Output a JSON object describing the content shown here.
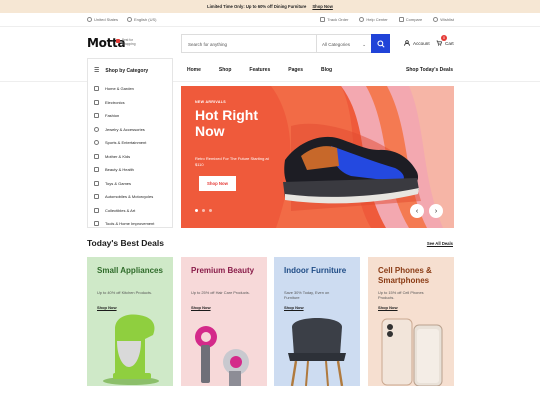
{
  "promo": {
    "text": "Limited Time Only: Up to 60% off Dining Furniture",
    "link": "Shop Now"
  },
  "utility": {
    "country": "United States",
    "language": "English (US)",
    "right": [
      "Track Order",
      "Help Center",
      "Compare",
      "Wishlist"
    ]
  },
  "header": {
    "logo": "Motta",
    "tagline": "Best for Shopping",
    "search_placeholder": "Search for anything",
    "category": "All Categories",
    "account": "Account",
    "cart": "Cart",
    "cart_count": "0"
  },
  "nav": {
    "shop_by": "Shop by Category",
    "items": [
      "Home",
      "Shop",
      "Features",
      "Pages",
      "Blog"
    ],
    "right": "Shop Today's Deals"
  },
  "sidebar": {
    "items": [
      "Home & Garden",
      "Electronics",
      "Fashion",
      "Jewelry & Accessories",
      "Sports & Entertainment",
      "Mother & Kids",
      "Beauty & Health",
      "Toys & Games",
      "Automobiles & Motorcycles",
      "Collectibles & Art",
      "Tools & Home Improvement"
    ]
  },
  "hero": {
    "tag": "NEW ARRIVALS",
    "title": "Hot Right Now",
    "subtitle": "Retro Remixed For The Future Starting at $110",
    "cta": "Shop Now",
    "colors": {
      "bg": "#f0623f",
      "accent": "#2043d8"
    }
  },
  "deals": {
    "title": "Today's Best Deals",
    "see_all": "See All Deals",
    "cards": [
      {
        "title": "Small Appliances",
        "desc": "Up to 40% off Kitchen Products.",
        "link": "Shop Now",
        "bg": "#cfe9c8",
        "title_color": "#2f6b2a"
      },
      {
        "title": "Premium Beauty",
        "desc": "Up to 25% off Hair Care Products.",
        "link": "Shop Now",
        "bg": "#f7d9d9",
        "title_color": "#8a1d4a"
      },
      {
        "title": "Indoor Furniture",
        "desc": "Save 30% Today, Even on Furniture",
        "link": "Shop Now",
        "bg": "#cddcf1",
        "title_color": "#1f4c86"
      },
      {
        "title": "Cell Phones & Smartphones",
        "desc": "Up to 15% off Cell Phones Products.",
        "link": "Shop Now",
        "bg": "#f6dfd0",
        "title_color": "#8a3b14"
      }
    ]
  }
}
